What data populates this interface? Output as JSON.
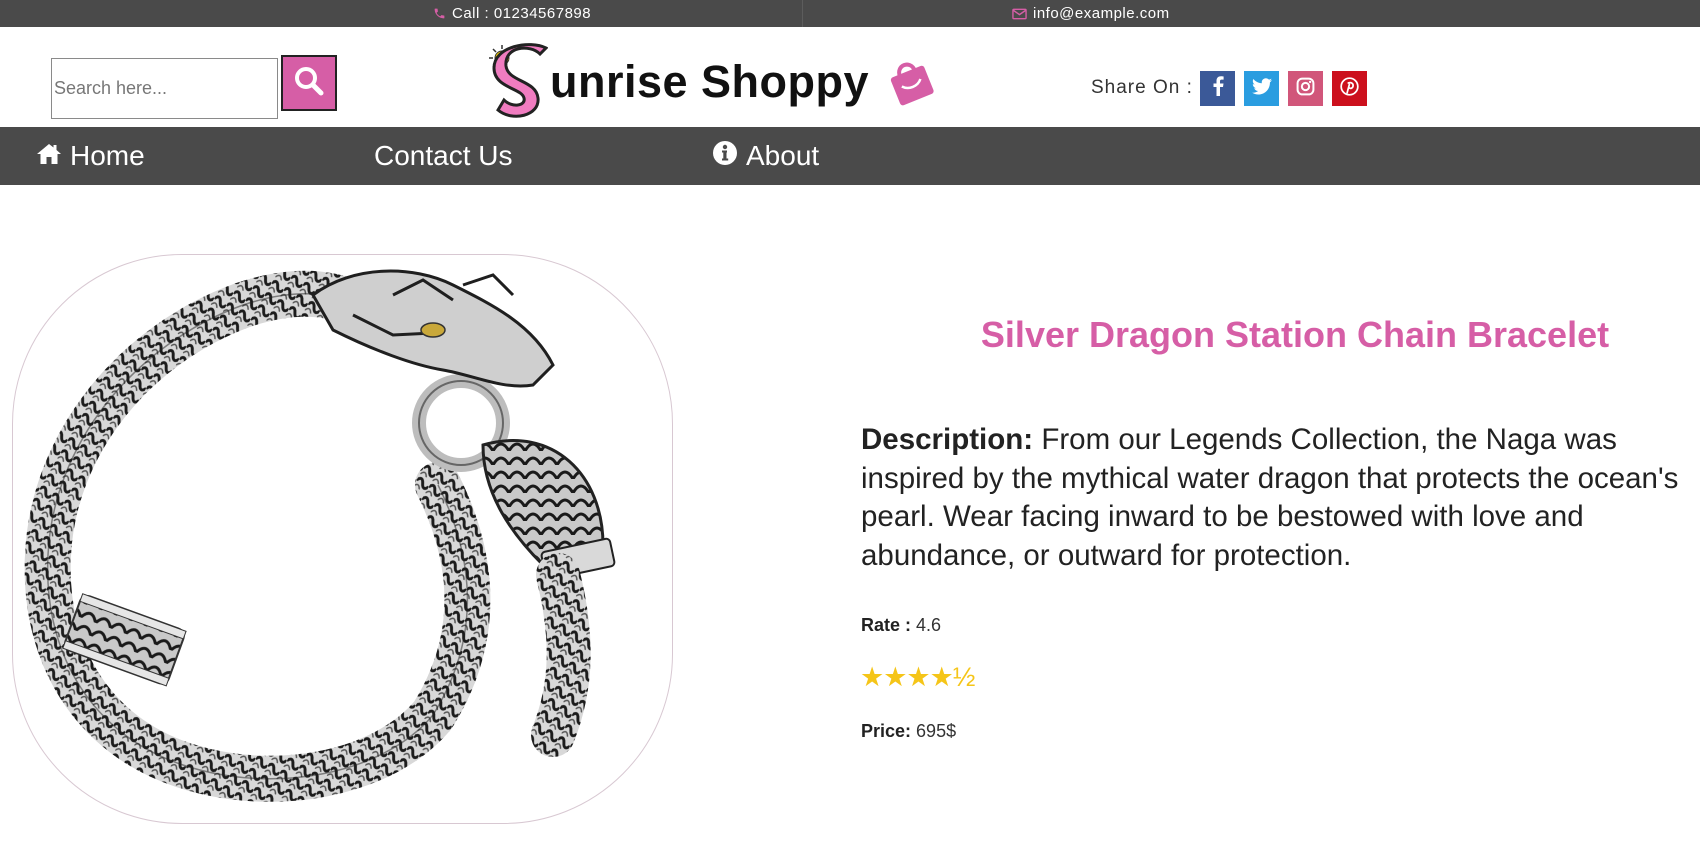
{
  "topbar": {
    "call": "Call : 01234567898",
    "email": "info@example.com",
    "icons": {
      "call": "phone-icon",
      "email": "envelope-icon"
    }
  },
  "header": {
    "search": {
      "placeholder": "Search here...",
      "value": ""
    },
    "logo_text": "unrise Shoppy",
    "share_label": "Share On :",
    "social": [
      "facebook-icon",
      "twitter-icon",
      "instagram-icon",
      "pinterest-icon"
    ]
  },
  "nav": {
    "home": "Home",
    "contact": "Contact Us",
    "about": "About"
  },
  "product": {
    "title": "Silver Dragon Station Chain Bracelet",
    "description_label": "Description:",
    "description": "From our Legends Collection, the Naga was inspired by the mythical water dragon that protects the ocean's pearl. Wear facing inward to be bestowed with love and abundance, or outward for protection.",
    "rate_label": "Rate :",
    "rate": "4.6",
    "stars": "★★★★½",
    "price_label": "Price:",
    "price": "695$"
  },
  "colors": {
    "accent": "#d65ea6",
    "bar": "#4a4a4a",
    "facebook": "#3b5998",
    "twitter": "#2a9de0",
    "instagram": "#d1567a",
    "pinterest": "#cc101d",
    "star": "#f5c518"
  }
}
